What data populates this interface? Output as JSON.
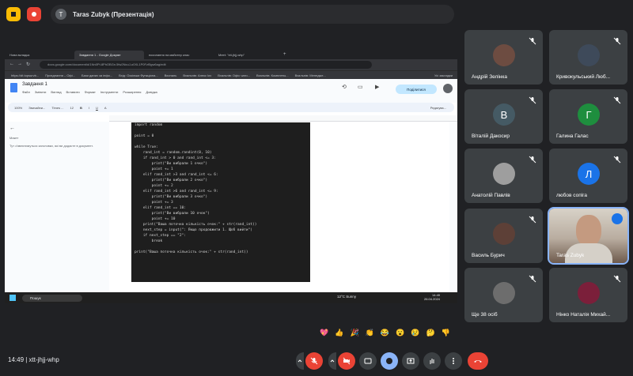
{
  "top": {
    "presenter_initial": "T",
    "presenter_label": "Taras Zubyk (Презентація)"
  },
  "browser": {
    "tabs": [
      "Нова вкладка",
      "Завдання 1 - Google Докуме",
      "посилання на майстер клас",
      "Meet: \"xtt-jhjj-whp\""
    ],
    "url": "docs.google.com/document/d/1Nn0Pt.8PhOBGn.5fw2NcuJ-o0XL1P0Fzf5gw6ag/edit",
    "bookmarks": [
      "https://dt.topsurvb...",
      "Приєднання – Офі...",
      "Бази даних за інфо...",
      "Вхід: Оскільки Функціона...",
      "Вхональ",
      "Вхальнів: Алекс lov",
      "Вхальнів: Офіс чати...",
      "Вхальнів: Комплеты...",
      "Вхальнів: Менедже...",
      "Усі закладки"
    ]
  },
  "docs": {
    "title": "Завдання 1",
    "menu": [
      "Файл",
      "Змінити",
      "Вигляд",
      "Вставити",
      "Формат",
      "Інструменти",
      "Розширення",
      "Довідка"
    ],
    "share_label": "Поділитися",
    "toolbar": [
      "100%",
      "Звичайни...",
      "Times ...",
      "12",
      "B",
      "I",
      "U",
      "A",
      "Редагува..."
    ],
    "outline_title": "Макет",
    "outline_hint": "Тут з'являтимуться заголовки, які ви додасте в документ.",
    "code_lines": [
      "import random",
      "",
      "point = 0",
      "",
      "while True:",
      "    rand_int = random.randint(0, 10)",
      "    if rand_int > 0 and rand_int <= 3:",
      "        print(\"Ви вибрали 1 очко\")",
      "        point += 1",
      "    elif rand_int >3 and rand_int <= 6:",
      "        print(\"Ви вибрали 2 очко\")",
      "        point += 2",
      "    elif rand_int >6 and rand_int <= 9:",
      "        print(\"Ви вибрали 3 очко\")",
      "        point += 3",
      "    elif rand_int == 10:",
      "        print(\"Ви вибрали 10 очок\")",
      "        point += 10",
      "    print(\"Ваша поточна кількість очок:\" + str(rand_int))",
      "    next_step = input(\": Якщо продовжити 1. Щоб вийти\")",
      "    if next_step == \"2\":",
      "        break",
      "",
      "print(\"Ваша поточна кількість очок:\" + str(rand_int))"
    ],
    "taskbar_search": "Пошук",
    "weather": "12°C  Sunny",
    "clock_time": "14:49",
    "clock_date": "26.04.2024"
  },
  "participants": [
    {
      "name": "Андрій Зелінка",
      "initial": "",
      "color": "#6d4c41"
    },
    {
      "name": "Кривокульський Люб...",
      "initial": "",
      "color": "#3e4a5a"
    },
    {
      "name": "Віталій Дакосир",
      "initial": "В",
      "color": "#455a64"
    },
    {
      "name": "Галина Галас",
      "initial": "Г",
      "color": "#1e8e3e"
    },
    {
      "name": "Анатолій Павлів",
      "initial": "",
      "color": "#9e9e9e"
    },
    {
      "name": "любов сопіга",
      "initial": "Л",
      "color": "#1a73e8"
    },
    {
      "name": "Василь Бурич",
      "initial": "",
      "color": "#5d4037"
    },
    {
      "name": "Taras Zubyk",
      "initial": "",
      "color": "#8d6e63"
    },
    {
      "name": "Ще 38 осіб",
      "initial": "",
      "color": "#6d6d6d"
    },
    {
      "name": "Нінко Наталія Михай...",
      "initial": "",
      "color": "#7b1f3a"
    }
  ],
  "reactions": [
    "💖",
    "👍",
    "🎉",
    "👏",
    "😂",
    "😮",
    "😢",
    "🤔",
    "👎"
  ],
  "bottom": {
    "time_code": "14:49  |  xtt-jhjj-whp"
  }
}
